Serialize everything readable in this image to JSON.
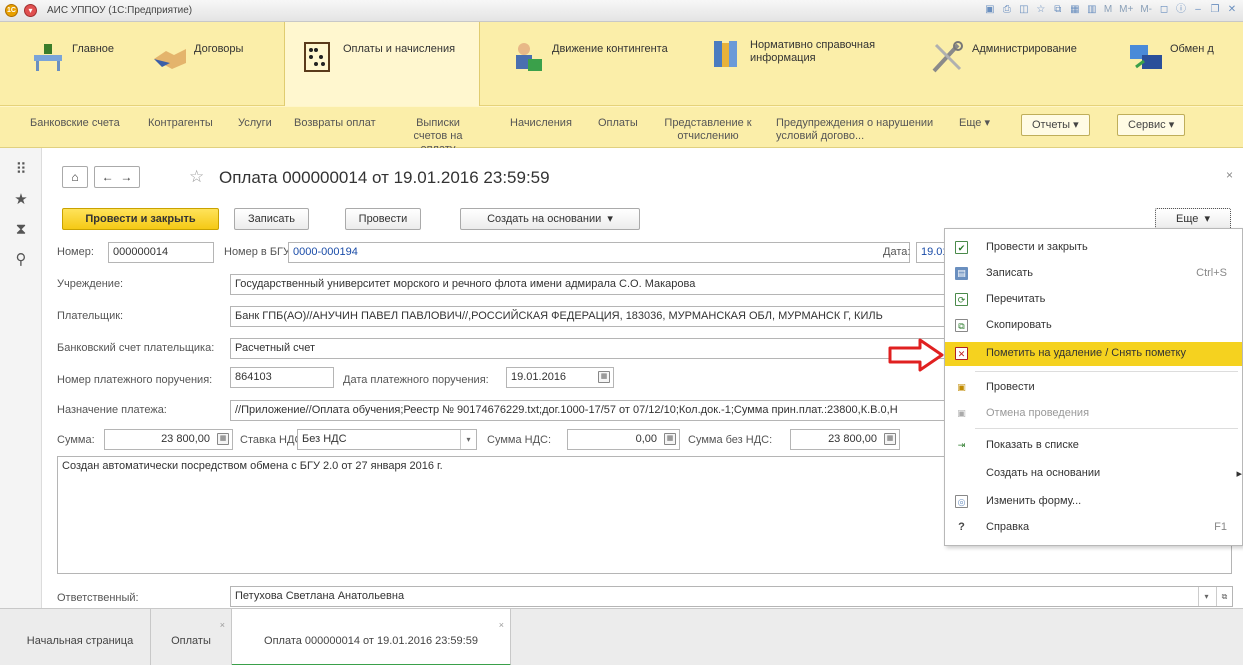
{
  "window": {
    "title": "АИС УППОУ (1С:Предприятие)",
    "tools": [
      "M",
      "M+",
      "M-"
    ]
  },
  "sections": [
    {
      "label": "Главное",
      "icon": "desk-icon"
    },
    {
      "label": "Договоры",
      "icon": "handshake-icon"
    },
    {
      "label": "Оплаты и начисления",
      "icon": "abacus-icon"
    },
    {
      "label": "Движение контингента",
      "icon": "person-icon"
    },
    {
      "label": "Нормативно справочная информация",
      "icon": "books-icon"
    },
    {
      "label": "Администрирование",
      "icon": "tools-icon"
    },
    {
      "label": "Обмен д",
      "icon": "exchange-icon"
    }
  ],
  "funcbar": {
    "items": [
      "Банковские счета",
      "Контрагенты",
      "Услуги",
      "Возвраты оплат",
      "Выписки счетов на оплату",
      "Начисления",
      "Оплаты",
      "Представление к отчислению",
      "Предупреждения о нарушении условий догово..."
    ],
    "more": "Еще",
    "reports": "Отчеты",
    "service": "Сервис"
  },
  "form": {
    "title": "Оплата 000000014 от 19.01.2016 23:59:59",
    "buttons": {
      "post_close": "Провести и закрыть",
      "save": "Записать",
      "post": "Провести",
      "create_based": "Создать на основании",
      "more": "Еще"
    },
    "fields": {
      "number_label": "Номер:",
      "number": "000000014",
      "bgu_label": "Номер в БГУ:",
      "bgu": "0000-000194",
      "date_label": "Дата:",
      "date": "19.01.2",
      "institution_label": "Учреждение:",
      "institution": "Государственный университет морского и речного флота имени адмирала С.О. Макарова",
      "payer_label": "Плательщик:",
      "payer": "Банк ГПБ(АО)//АНУЧИН ПАВЕЛ ПАВЛОВИЧ//,РОССИЙСКАЯ ФЕДЕРАЦИЯ, 183036, МУРМАНСКАЯ ОБЛ, МУРМАНСК Г, КИЛЬ",
      "account_label": "Банковский счет плательщика:",
      "account": "Расчетный счет",
      "order_no_label": "Номер платежного поручения:",
      "order_no": "864103",
      "order_date_label": "Дата платежного поручения:",
      "order_date": "19.01.2016",
      "purpose_label": "Назначение платежа:",
      "purpose": "//Приложение//Оплата обучения;Реестр № 90174676229.txt;дог.1000-17/57 от 07/12/10;Кол.док.-1;Сумма прин.плат.:23800,К.В.0,Н",
      "sum_label": "Сумма:",
      "sum": "23 800,00",
      "vat_rate_label": "Ставка НДС:",
      "vat_rate": "Без НДС",
      "vat_sum_label": "Сумма НДС:",
      "vat_sum": "0,00",
      "sum_no_vat_label": "Сумма без НДС:",
      "sum_no_vat": "23 800,00",
      "comment": "Создан автоматически посредством обмена с БГУ 2.0 от 27 января 2016 г.",
      "responsible_label": "Ответственный:",
      "responsible": "Петухова Светлана Анатольевна"
    }
  },
  "menu": [
    {
      "label": "Провести и закрыть",
      "key": "",
      "icon": "post-close-icon"
    },
    {
      "label": "Записать",
      "key": "Ctrl+S",
      "icon": "save-icon"
    },
    {
      "label": "Перечитать",
      "key": "",
      "icon": "reread-icon"
    },
    {
      "label": "Скопировать",
      "key": "",
      "icon": "copy-icon"
    },
    {
      "label": "Пометить на удаление / Снять пометку",
      "key": "",
      "icon": "delete-mark-icon"
    },
    {
      "label": "Провести",
      "key": "",
      "icon": "post-icon"
    },
    {
      "label": "Отмена проведения",
      "key": "",
      "icon": "unpost-icon"
    },
    {
      "label": "Показать в списке",
      "key": "",
      "icon": "show-list-icon"
    },
    {
      "label": "Создать на основании",
      "key": "",
      "icon": ""
    },
    {
      "label": "Изменить форму...",
      "key": "",
      "icon": "change-form-icon"
    },
    {
      "label": "Справка",
      "key": "F1",
      "icon": "help-icon"
    }
  ],
  "tabs": [
    {
      "label": "Начальная страница"
    },
    {
      "label": "Оплаты"
    },
    {
      "label": "Оплата 000000014 от 19.01.2016 23:59:59"
    }
  ],
  "colors": {
    "sections_bg": "#fbeea9",
    "primary_btn": "#f5c915",
    "highlight": "#f5d21f",
    "arrow": "#e02020",
    "link": "#1a4ca8"
  }
}
